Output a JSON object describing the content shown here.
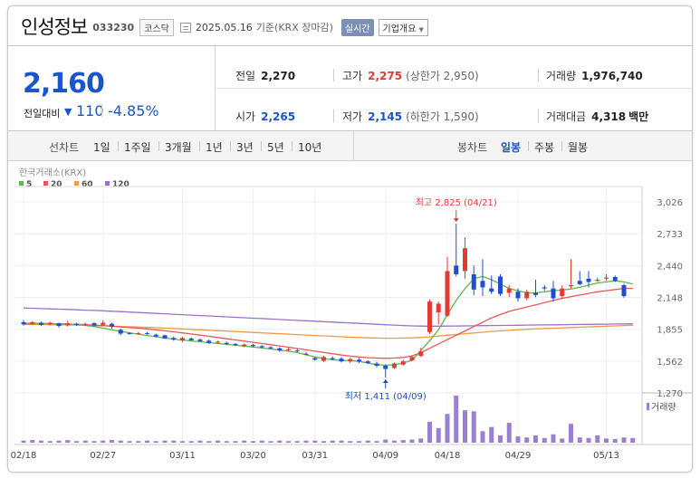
{
  "header": {
    "name": "인성정보",
    "code": "033230",
    "market": "코스닥",
    "date": "2025.05.16",
    "basis": "기준(KRX 장마감)",
    "realtime": "실시간",
    "company": "기업개요"
  },
  "quote": {
    "price": "2,160",
    "change_label": "전일대비",
    "change_value": "110",
    "change_pct": "-4.85%",
    "prev_close_label": "전일",
    "prev_close": "2,270",
    "high_label": "고가",
    "high": "2,275",
    "upper_limit": "(상한가 2,950)",
    "volume_label": "거래량",
    "volume": "1,976,740",
    "open_label": "시가",
    "open": "2,265",
    "low_label": "저가",
    "low": "2,145",
    "lower_limit": "(하한가 1,590)",
    "amount_label": "거래대금",
    "amount": "4,318",
    "amount_unit": "백만"
  },
  "tabs": {
    "line_label": "선차트",
    "periods": [
      "1일",
      "1주일",
      "3개월",
      "1년",
      "3년",
      "5년",
      "10년"
    ],
    "candle_label": "봉차트",
    "candles": [
      "일봉",
      "주봉",
      "월봉"
    ],
    "active_candle": 0
  },
  "colors": {
    "up": "#e53935",
    "down": "#1e4fd0",
    "ma5": "#5cb84a",
    "ma20": "#e8595a",
    "ma60": "#ee9b45",
    "ma120": "#9b72c9",
    "volume": "#9b7fd0"
  },
  "chart_data": {
    "type": "candlestick",
    "source": "한국거래소(KRX)",
    "legend": [
      "5",
      "20",
      "60",
      "120"
    ],
    "volume_label": "거래량",
    "x_ticks": [
      "02/18",
      "02/27",
      "03/11",
      "03/20",
      "03/31",
      "04/09",
      "04/18",
      "04/29",
      "05/13"
    ],
    "y_ticks": [
      "3,026",
      "2,733",
      "2,440",
      "2,148",
      "1,855",
      "1,562",
      "1,270"
    ],
    "y_tick_values": [
      3026,
      2733,
      2440,
      2148,
      1855,
      1562,
      1270
    ],
    "ylim": [
      1270,
      3026
    ],
    "annotations": {
      "high": {
        "label": "최고 2,825 (04/21)",
        "value": 2825
      },
      "low": {
        "label": "최저 1,411 (04/09)",
        "value": 1411
      }
    },
    "candles": [
      {
        "o": 1920,
        "c": 1900,
        "h": 1940,
        "l": 1890
      },
      {
        "o": 1905,
        "c": 1920,
        "h": 1930,
        "l": 1895
      },
      {
        "o": 1915,
        "c": 1895,
        "h": 1925,
        "l": 1885
      },
      {
        "o": 1900,
        "c": 1915,
        "h": 1925,
        "l": 1890
      },
      {
        "o": 1910,
        "c": 1885,
        "h": 1915,
        "l": 1870
      },
      {
        "o": 1890,
        "c": 1910,
        "h": 1935,
        "l": 1880
      },
      {
        "o": 1905,
        "c": 1895,
        "h": 1915,
        "l": 1885
      },
      {
        "o": 1895,
        "c": 1905,
        "h": 1915,
        "l": 1885
      },
      {
        "o": 1910,
        "c": 1890,
        "h": 1920,
        "l": 1880
      },
      {
        "o": 1895,
        "c": 1915,
        "h": 1940,
        "l": 1885
      },
      {
        "o": 1905,
        "c": 1880,
        "h": 1915,
        "l": 1860
      },
      {
        "o": 1850,
        "c": 1815,
        "h": 1860,
        "l": 1800
      },
      {
        "o": 1820,
        "c": 1815,
        "h": 1830,
        "l": 1805
      },
      {
        "o": 1815,
        "c": 1820,
        "h": 1830,
        "l": 1805
      },
      {
        "o": 1820,
        "c": 1815,
        "h": 1830,
        "l": 1805
      },
      {
        "o": 1805,
        "c": 1790,
        "h": 1815,
        "l": 1780
      },
      {
        "o": 1800,
        "c": 1770,
        "h": 1805,
        "l": 1765
      },
      {
        "o": 1775,
        "c": 1760,
        "h": 1790,
        "l": 1750
      },
      {
        "o": 1750,
        "c": 1775,
        "h": 1785,
        "l": 1740
      },
      {
        "o": 1770,
        "c": 1755,
        "h": 1780,
        "l": 1745
      },
      {
        "o": 1760,
        "c": 1745,
        "h": 1770,
        "l": 1740
      },
      {
        "o": 1750,
        "c": 1730,
        "h": 1760,
        "l": 1720
      },
      {
        "o": 1735,
        "c": 1740,
        "h": 1750,
        "l": 1725
      },
      {
        "o": 1730,
        "c": 1720,
        "h": 1740,
        "l": 1710
      },
      {
        "o": 1720,
        "c": 1710,
        "h": 1730,
        "l": 1700
      },
      {
        "o": 1700,
        "c": 1715,
        "h": 1725,
        "l": 1690
      },
      {
        "o": 1710,
        "c": 1700,
        "h": 1720,
        "l": 1690
      },
      {
        "o": 1700,
        "c": 1690,
        "h": 1710,
        "l": 1680
      },
      {
        "o": 1690,
        "c": 1680,
        "h": 1700,
        "l": 1670
      },
      {
        "o": 1680,
        "c": 1660,
        "h": 1690,
        "l": 1650
      },
      {
        "o": 1665,
        "c": 1670,
        "h": 1685,
        "l": 1655
      },
      {
        "o": 1660,
        "c": 1655,
        "h": 1675,
        "l": 1645
      },
      {
        "o": 1630,
        "c": 1625,
        "h": 1645,
        "l": 1615
      },
      {
        "o": 1590,
        "c": 1575,
        "h": 1600,
        "l": 1565
      },
      {
        "o": 1565,
        "c": 1600,
        "h": 1610,
        "l": 1555
      },
      {
        "o": 1590,
        "c": 1580,
        "h": 1605,
        "l": 1570
      },
      {
        "o": 1585,
        "c": 1560,
        "h": 1600,
        "l": 1550
      },
      {
        "o": 1560,
        "c": 1580,
        "h": 1595,
        "l": 1545
      },
      {
        "o": 1575,
        "c": 1560,
        "h": 1590,
        "l": 1545
      },
      {
        "o": 1560,
        "c": 1545,
        "h": 1570,
        "l": 1535
      },
      {
        "o": 1540,
        "c": 1520,
        "h": 1555,
        "l": 1505
      },
      {
        "o": 1520,
        "c": 1490,
        "h": 1530,
        "l": 1411
      },
      {
        "o": 1500,
        "c": 1540,
        "h": 1550,
        "l": 1490
      },
      {
        "o": 1530,
        "c": 1560,
        "h": 1575,
        "l": 1520
      },
      {
        "o": 1570,
        "c": 1600,
        "h": 1615,
        "l": 1560
      },
      {
        "o": 1610,
        "c": 1650,
        "h": 1685,
        "l": 1600
      },
      {
        "o": 1830,
        "c": 2110,
        "h": 2130,
        "l": 1810
      },
      {
        "o": 2010,
        "c": 2090,
        "h": 2110,
        "l": 1900
      },
      {
        "o": 1980,
        "c": 2390,
        "h": 2520,
        "l": 1970
      },
      {
        "o": 2440,
        "c": 2360,
        "h": 2825,
        "l": 2340
      },
      {
        "o": 2390,
        "c": 2600,
        "h": 2700,
        "l": 2320
      },
      {
        "o": 2360,
        "c": 2220,
        "h": 2440,
        "l": 2170
      },
      {
        "o": 2300,
        "c": 2240,
        "h": 2500,
        "l": 2160
      },
      {
        "o": 2230,
        "c": 2200,
        "h": 2350,
        "l": 2180
      },
      {
        "o": 2340,
        "c": 2180,
        "h": 2360,
        "l": 2160
      },
      {
        "o": 2190,
        "c": 2230,
        "h": 2260,
        "l": 2150
      },
      {
        "o": 2200,
        "c": 2140,
        "h": 2230,
        "l": 2110
      },
      {
        "o": 2140,
        "c": 2200,
        "h": 2220,
        "l": 2120
      },
      {
        "o": 2190,
        "c": 2170,
        "h": 2310,
        "l": 2150
      },
      {
        "o": 2240,
        "c": 2230,
        "h": 2260,
        "l": 2210
      },
      {
        "o": 2230,
        "c": 2140,
        "h": 2300,
        "l": 2110
      },
      {
        "o": 2160,
        "c": 2230,
        "h": 2260,
        "l": 2140
      },
      {
        "o": 2250,
        "c": 2260,
        "h": 2500,
        "l": 2230
      },
      {
        "o": 2300,
        "c": 2270,
        "h": 2390,
        "l": 2260
      },
      {
        "o": 2320,
        "c": 2290,
        "h": 2390,
        "l": 2240
      },
      {
        "o": 2300,
        "c": 2310,
        "h": 2330,
        "l": 2290
      },
      {
        "o": 2320,
        "c": 2330,
        "h": 2360,
        "l": 2300
      },
      {
        "o": 2335,
        "c": 2300,
        "h": 2350,
        "l": 2290
      },
      {
        "o": 2260,
        "c": 2160,
        "h": 2275,
        "l": 2145
      }
    ],
    "ma5": [
      1905,
      1906,
      1907,
      1905,
      1904,
      1902,
      1898,
      1890,
      1880,
      1866,
      1850,
      1836,
      1822,
      1810,
      1798,
      1786,
      1774,
      1764,
      1756,
      1748,
      1740,
      1732,
      1724,
      1716,
      1708,
      1700,
      1692,
      1684,
      1674,
      1664,
      1654,
      1640,
      1620,
      1600,
      1585,
      1575,
      1568,
      1566,
      1560,
      1545,
      1530,
      1525,
      1530,
      1545,
      1570,
      1660,
      1750,
      1850,
      1990,
      2120,
      2230,
      2320,
      2340,
      2310,
      2270,
      2230,
      2210,
      2190,
      2190,
      2200,
      2210,
      2215,
      2225,
      2240,
      2260,
      2280,
      2290,
      2300,
      2290,
      2270
    ],
    "ma20": [
      1910,
      1910,
      1908,
      1907,
      1905,
      1903,
      1900,
      1897,
      1893,
      1888,
      1883,
      1877,
      1871,
      1865,
      1858,
      1850,
      1841,
      1832,
      1822,
      1812,
      1801,
      1790,
      1779,
      1768,
      1757,
      1746,
      1735,
      1724,
      1713,
      1702,
      1690,
      1678,
      1666,
      1654,
      1642,
      1630,
      1618,
      1608,
      1600,
      1594,
      1590,
      1588,
      1590,
      1596,
      1610,
      1640,
      1680,
      1720,
      1760,
      1800,
      1840,
      1880,
      1920,
      1960,
      1990,
      2020,
      2040,
      2060,
      2080,
      2100,
      2120,
      2140,
      2155,
      2170,
      2185,
      2200,
      2210,
      2220,
      2230,
      2230
    ],
    "ma60": [
      1900,
      1899,
      1898,
      1897,
      1896,
      1895,
      1893,
      1891,
      1889,
      1887,
      1884,
      1881,
      1878,
      1875,
      1872,
      1869,
      1866,
      1862,
      1858,
      1854,
      1850,
      1846,
      1842,
      1838,
      1834,
      1830,
      1826,
      1822,
      1818,
      1814,
      1810,
      1806,
      1802,
      1798,
      1794,
      1790,
      1786,
      1782,
      1779,
      1776,
      1774,
      1773,
      1773,
      1774,
      1776,
      1780,
      1786,
      1793,
      1800,
      1807,
      1814,
      1821,
      1828,
      1835,
      1840,
      1845,
      1850,
      1855,
      1859,
      1862,
      1865,
      1868,
      1871,
      1874,
      1877,
      1880,
      1883,
      1886,
      1889,
      1892
    ],
    "ma120": [
      2050,
      2048,
      2045,
      2042,
      2040,
      2037,
      2034,
      2031,
      2028,
      2025,
      2021,
      2017,
      2013,
      2009,
      2005,
      2001,
      1997,
      1993,
      1989,
      1985,
      1981,
      1977,
      1973,
      1969,
      1965,
      1961,
      1957,
      1953,
      1949,
      1945,
      1941,
      1937,
      1933,
      1929,
      1925,
      1921,
      1917,
      1913,
      1909,
      1905,
      1901,
      1897,
      1893,
      1889,
      1886,
      1884,
      1883,
      1883,
      1884,
      1885,
      1886,
      1887,
      1888,
      1889,
      1890,
      1891,
      1892,
      1893,
      1894,
      1895,
      1896,
      1897,
      1898,
      1899,
      1900,
      1901,
      1902,
      1903,
      1904,
      1905
    ],
    "volume": [
      4,
      5,
      4,
      3,
      4,
      5,
      3,
      4,
      3,
      4,
      5,
      4,
      3,
      3,
      4,
      3,
      4,
      4,
      3,
      3,
      4,
      3,
      4,
      3,
      3,
      4,
      3,
      4,
      3,
      4,
      3,
      3,
      4,
      4,
      3,
      4,
      4,
      3,
      3,
      4,
      3,
      6,
      4,
      5,
      6,
      8,
      40,
      28,
      55,
      90,
      62,
      60,
      22,
      30,
      14,
      38,
      12,
      10,
      14,
      9,
      16,
      8,
      36,
      10,
      9,
      14,
      8,
      7,
      10,
      9
    ]
  }
}
